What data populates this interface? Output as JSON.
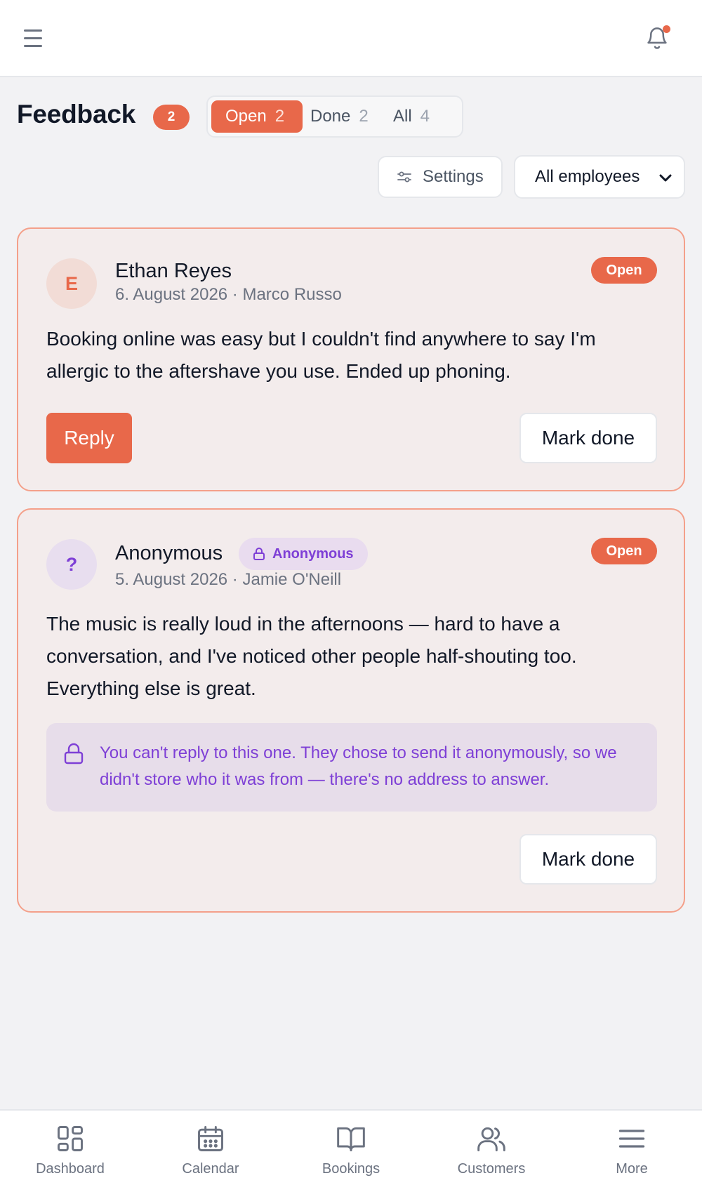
{
  "header": {
    "menu_icon": "hamburger-menu-icon",
    "bell_icon": "bell-icon",
    "has_notification_dot": true
  },
  "page": {
    "title": "Feedback",
    "badge_count": "2"
  },
  "tabs": [
    {
      "label": "Open",
      "count": "2",
      "active": true
    },
    {
      "label": "Done",
      "count": "2",
      "active": false
    },
    {
      "label": "All",
      "count": "4",
      "active": false
    }
  ],
  "controls": {
    "settings_label": "Settings",
    "employee_filter": "All employees"
  },
  "feedback": [
    {
      "avatar_initial": "E",
      "name": "Ethan Reyes",
      "meta": "6. August 2026 · Marco Russo",
      "status": "Open",
      "message": "Booking online was easy but I couldn't find anywhere to say I'm allergic to the aftershave you use. Ended up phoning.",
      "reply_label": "Reply",
      "done_label": "Mark done"
    },
    {
      "avatar_initial": "?",
      "name": "Anonymous",
      "anon_chip": "Anonymous",
      "meta": "5. August 2026 · Jamie O'Neill",
      "status": "Open",
      "message": "The music is really loud in the afternoons — hard to have a conversation, and I've noticed other people half-shouting too. Everything else is great.",
      "notice": "You can't reply to this one. They chose to send it anonymously, so we didn't store who it was from — there's no address to answer.",
      "done_label": "Mark done"
    }
  ],
  "bottom_nav": [
    {
      "label": "Dashboard",
      "icon": "dashboard-icon"
    },
    {
      "label": "Calendar",
      "icon": "calendar-icon"
    },
    {
      "label": "Bookings",
      "icon": "book-icon"
    },
    {
      "label": "Customers",
      "icon": "users-icon"
    },
    {
      "label": "More",
      "icon": "more-menu-icon"
    }
  ],
  "colors": {
    "accent": "#e8684a",
    "card_bg": "#f3ecec",
    "card_border": "#f4a08a",
    "anon_purple": "#7e3fd6",
    "anon_bg": "#e7ddea"
  }
}
